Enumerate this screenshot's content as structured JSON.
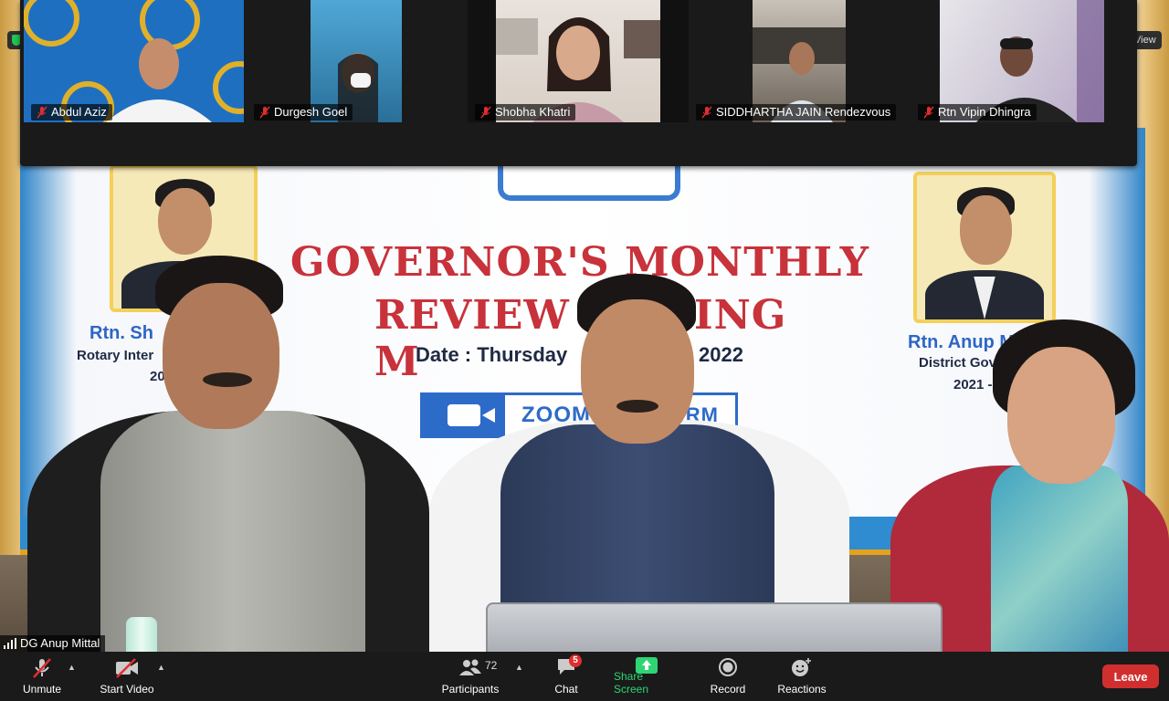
{
  "gallery": {
    "participants": [
      {
        "name": "Abdul Aziz",
        "muted": true
      },
      {
        "name": "Durgesh Goel",
        "muted": true
      },
      {
        "name": "Shobha Khatri",
        "muted": true
      },
      {
        "name": "SIDDHARTHA JAIN Rendezvous",
        "muted": true
      },
      {
        "name": "Rtn Vipin Dhingra",
        "muted": true
      }
    ]
  },
  "top_bar": {
    "view_label": "View"
  },
  "main_video": {
    "speaker_name": "DG Anup Mittal",
    "banner": {
      "title_line1": "GOVERNOR'S MONTHLY",
      "title_line2": "REVIEW M",
      "title_line2_end": "ING",
      "date_label": "Date : Thursday",
      "date_year": "2022",
      "left_name": "Rtn. Sh",
      "left_role": "Rotary Inter",
      "left_year": "20",
      "right_name": "Rtn. Anup M",
      "right_role": "District Gov",
      "right_year": "2021 -",
      "zoom_text": "ZOOM",
      "zoom_text_end": "RM"
    }
  },
  "toolbar": {
    "unmute_label": "Unmute",
    "start_video_label": "Start Video",
    "participants_label": "Participants",
    "participants_count": "72",
    "chat_label": "Chat",
    "chat_badge": "5",
    "share_screen_label": "Share Screen",
    "record_label": "Record",
    "reactions_label": "Reactions",
    "leave_label": "Leave"
  },
  "colors": {
    "leave_red": "#d12f2f",
    "share_green": "#2ed573",
    "mute_red": "#e02d2d",
    "banner_title_red": "#c8323a"
  }
}
